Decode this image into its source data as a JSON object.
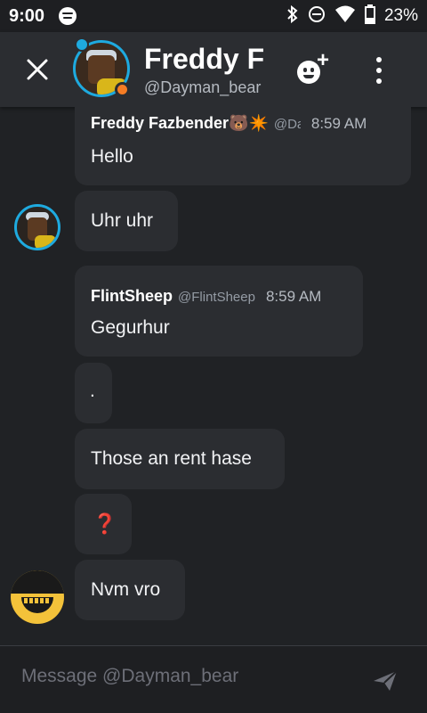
{
  "status_bar": {
    "time": "9:00",
    "battery_percent": "23%",
    "icons": [
      "spotify-icon",
      "bluetooth-icon",
      "do-not-disturb-icon",
      "wifi-icon",
      "battery-icon"
    ]
  },
  "header": {
    "name": "Freddy Fa",
    "username": "@Dayman_bear",
    "status_color": "#f57c24",
    "avatar_ring_color": "#1eaadf"
  },
  "messages": [
    {
      "author": "Freddy Fazbender",
      "author_emojis": "🐻✴️",
      "handle": "@Da",
      "time": "8:59 AM",
      "text": "Hello"
    },
    {
      "text": "Uhr uhr"
    },
    {
      "author": "FlintSheep",
      "handle": "@FlintSheep",
      "time": "8:59 AM",
      "text": "Gegurhur"
    },
    {
      "text": "."
    },
    {
      "text": "Those an rent hase"
    },
    {
      "text": "❓"
    },
    {
      "text": "Nvm vro"
    }
  ],
  "composer": {
    "placeholder": "Message @Dayman_bear"
  },
  "colors": {
    "background": "#202225",
    "bubble": "#2b2d31",
    "header": "#2b2d31"
  }
}
